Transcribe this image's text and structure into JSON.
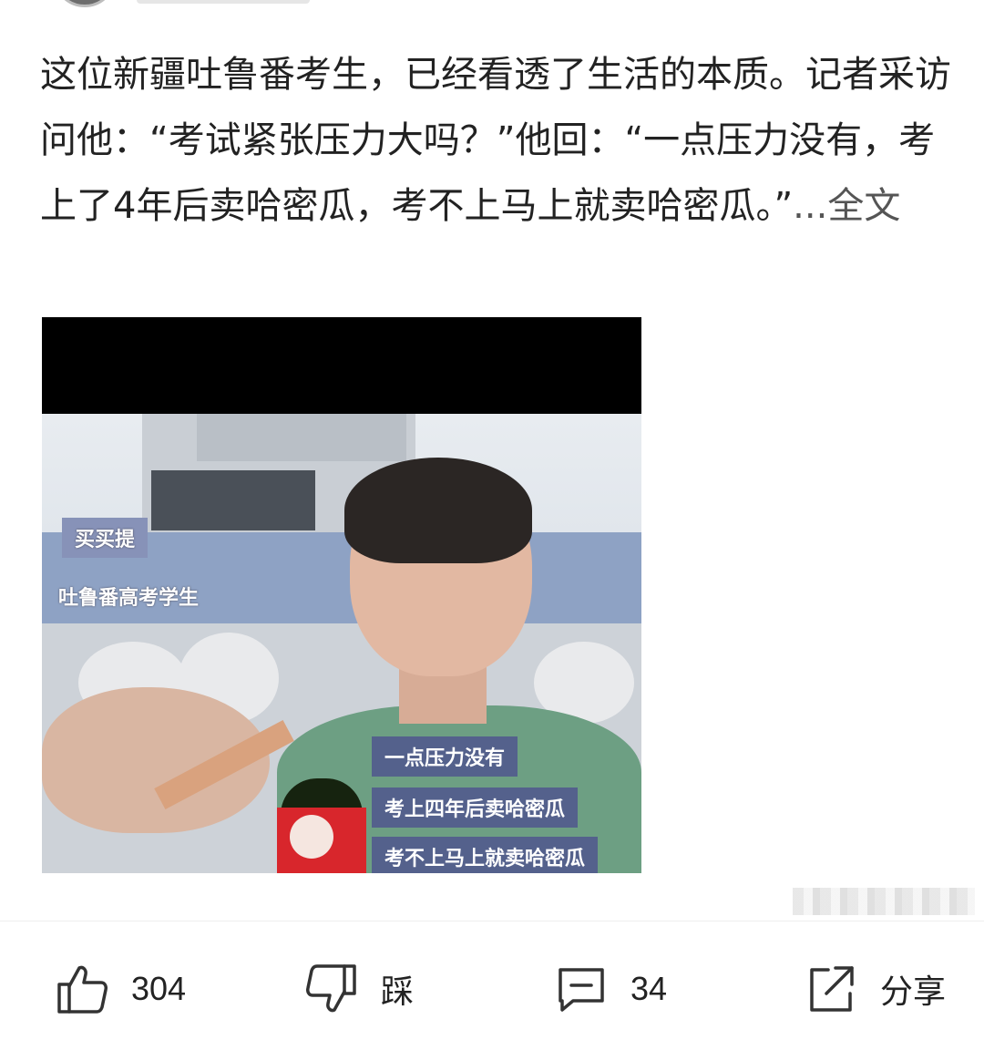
{
  "post": {
    "text": "这位新疆吐鲁番考生，已经看透了生活的本质。记者采访问他：“考试紧张压力大吗？”他回：“一点压力没有，考上了4年后卖哈密瓜，考不上马上就卖哈密瓜。”",
    "more_link": "...全文"
  },
  "media": {
    "name_tag": "买买提",
    "desc_tag": "吐鲁番高考学生",
    "captions": [
      "一点压力没有",
      "考上四年后卖哈密瓜",
      "考不上马上就卖哈密瓜"
    ]
  },
  "actions": {
    "like": {
      "icon": "thumbs-up-icon",
      "label": "304"
    },
    "dislike": {
      "icon": "thumbs-down-icon",
      "label": "踩"
    },
    "comment": {
      "icon": "comment-icon",
      "label": "34"
    },
    "share": {
      "icon": "share-icon",
      "label": "分享"
    }
  },
  "colors": {
    "text": "#222222",
    "icon": "#333333",
    "caption_bg": "#54618c"
  }
}
